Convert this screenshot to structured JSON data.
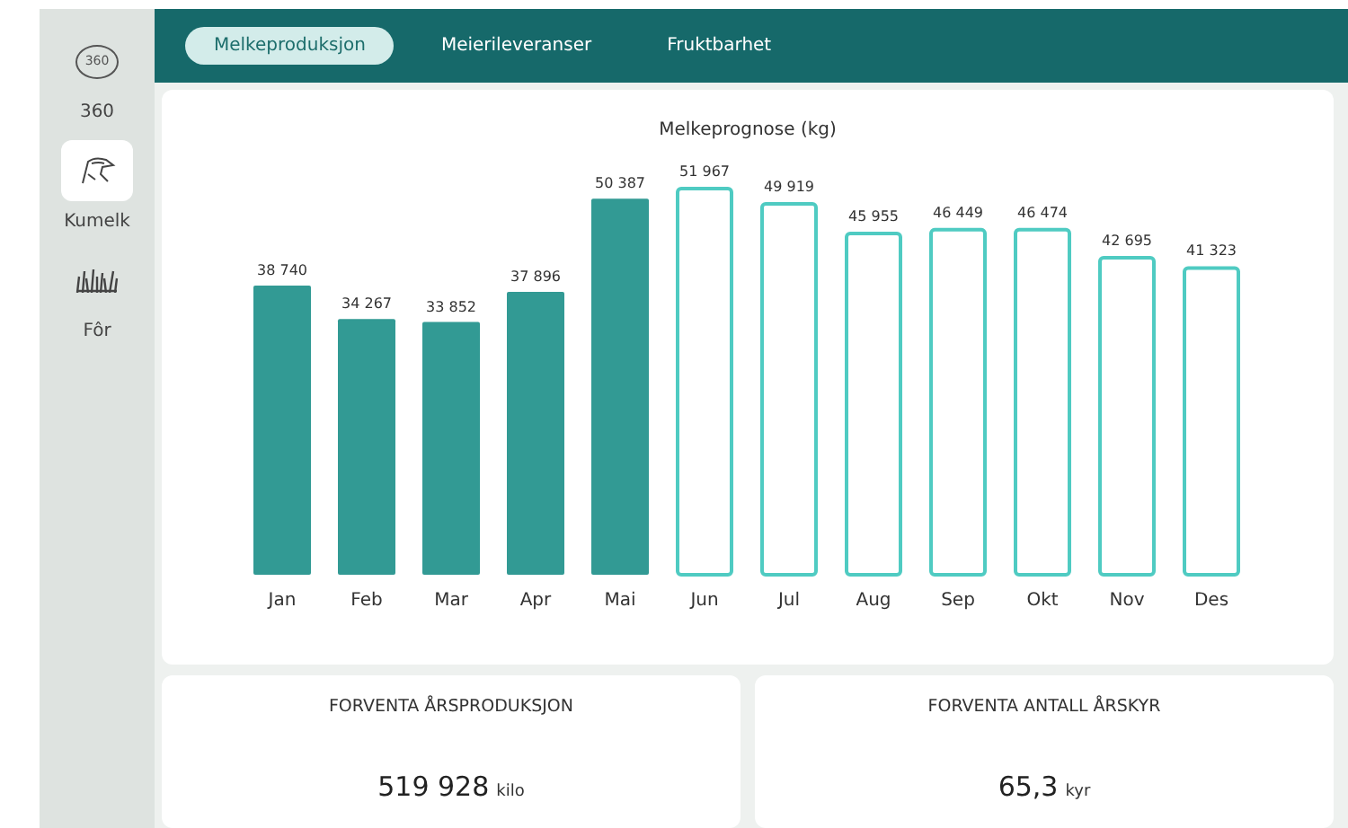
{
  "sidebar": {
    "items": [
      {
        "kind": "circle360",
        "badge": "360",
        "label": "360",
        "selected": false
      },
      {
        "kind": "cow",
        "label": "Kumelk",
        "selected": true
      },
      {
        "kind": "grass",
        "label": "Fôr",
        "selected": false
      }
    ]
  },
  "tabs": [
    {
      "label": "Melkeproduksjon",
      "selected": true
    },
    {
      "label": "Meierileveranser",
      "selected": false
    },
    {
      "label": "Fruktbarhet",
      "selected": false
    }
  ],
  "chart": {
    "chart_data": {
      "type": "bar",
      "title": "Melkeprognose (kg)",
      "categories": [
        "Jan",
        "Feb",
        "Mar",
        "Apr",
        "Mai",
        "Jun",
        "Jul",
        "Aug",
        "Sep",
        "Okt",
        "Nov",
        "Des"
      ],
      "stacked": true,
      "data_labels": true,
      "series": [
        {
          "color": "#329a94",
          "values": [
            38740,
            34267,
            33852,
            37896,
            50387,
            null,
            null,
            null,
            null,
            null,
            null,
            null
          ]
        },
        {
          "color": "#4fcbc2",
          "values": [
            null,
            null,
            null,
            null,
            null,
            51967,
            49919,
            45955,
            46449,
            46474,
            42695,
            41323
          ]
        }
      ]
    },
    "value_labels": [
      "38 740",
      "34 267",
      "33 852",
      "37 896",
      "50 387",
      "51 967",
      "49 919",
      "45 955",
      "46 449",
      "46 474",
      "42 695",
      "41 323"
    ]
  },
  "stats": [
    {
      "title": "FORVENTA ÅRSPRODUKSJON",
      "value": "519 928",
      "unit": "kilo"
    },
    {
      "title": "FORVENTA ANTALL ÅRSKYR",
      "value": "65,3",
      "unit": "kyr"
    }
  ]
}
